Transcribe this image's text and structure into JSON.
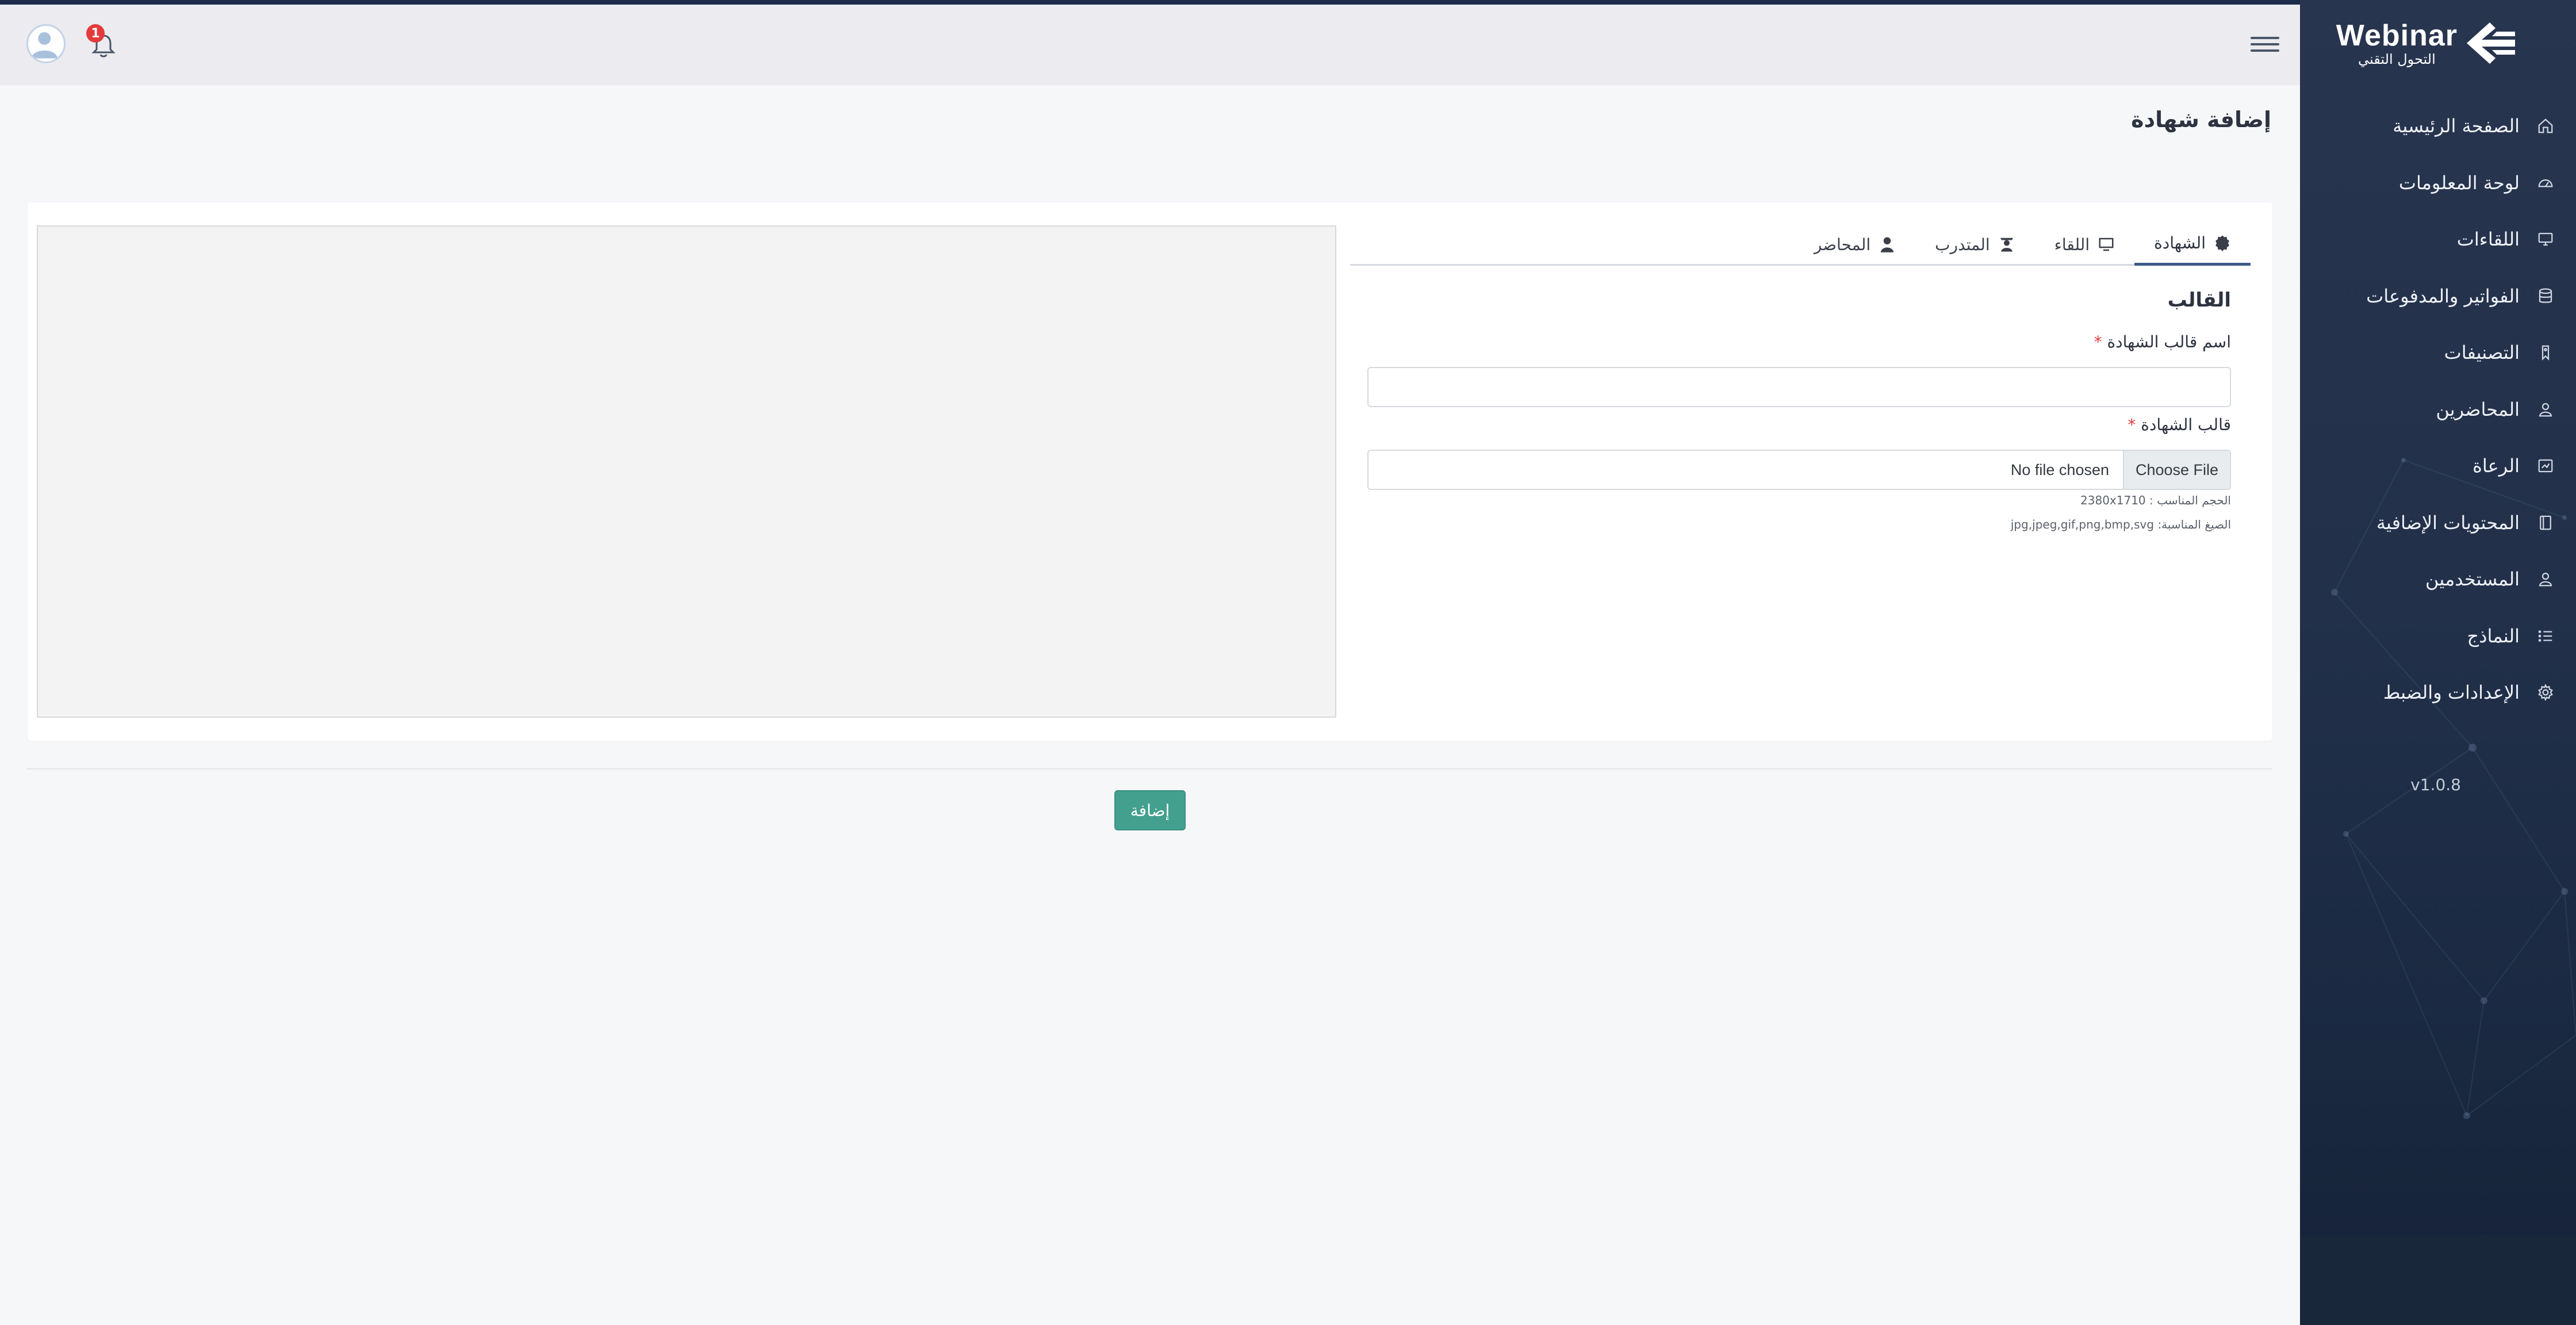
{
  "app": {
    "logo_text": "Webinar",
    "logo_subtitle": "التحول التقني",
    "version": "v1.0.8"
  },
  "sidebar": {
    "items": [
      {
        "label": "الصفحة الرئيسية",
        "icon": "home-icon"
      },
      {
        "label": "لوحة المعلومات",
        "icon": "dashboard-icon"
      },
      {
        "label": "اللقاءات",
        "icon": "monitor-icon"
      },
      {
        "label": "الفواتير والمدفوعات",
        "icon": "database-icon"
      },
      {
        "label": "التصنيفات",
        "icon": "tag-icon"
      },
      {
        "label": "المحاضرين",
        "icon": "user-icon"
      },
      {
        "label": "الرعاة",
        "icon": "sponsors-icon"
      },
      {
        "label": "المحتويات الإضافية",
        "icon": "book-icon"
      },
      {
        "label": "المستخدمين",
        "icon": "users-icon"
      },
      {
        "label": "النماذج",
        "icon": "list-icon"
      },
      {
        "label": "الإعدادات والضبط",
        "icon": "gear-icon"
      }
    ]
  },
  "header": {
    "notification_count": "1"
  },
  "page": {
    "title": "إضافة شهادة"
  },
  "tabs": [
    {
      "label": "الشهادة",
      "icon": "badge-icon",
      "active": true
    },
    {
      "label": "اللقاء",
      "icon": "monitor-icon",
      "active": false
    },
    {
      "label": "المتدرب",
      "icon": "graduate-icon",
      "active": false
    },
    {
      "label": "المحاضر",
      "icon": "user-icon",
      "active": false
    }
  ],
  "form": {
    "section_title": "القالب",
    "name_label": "اسم قالب الشهادة",
    "name_value": "",
    "template_label": "قالب الشهادة",
    "required_mark": "*",
    "file_button": "Choose File",
    "file_status": "No file chosen",
    "size_hint": "الحجم المناسب : 2380x1710",
    "formats_hint": "الصيغ المناسبة: jpg,jpeg,gif,png,bmp,svg"
  },
  "actions": {
    "submit_label": "إضافة"
  },
  "colors": {
    "sidebar_bg": "#22304a",
    "primary_button": "#43a08f",
    "active_tab_border": "#3d5a86",
    "required": "#e23b3b",
    "badge": "#e23b3b"
  }
}
